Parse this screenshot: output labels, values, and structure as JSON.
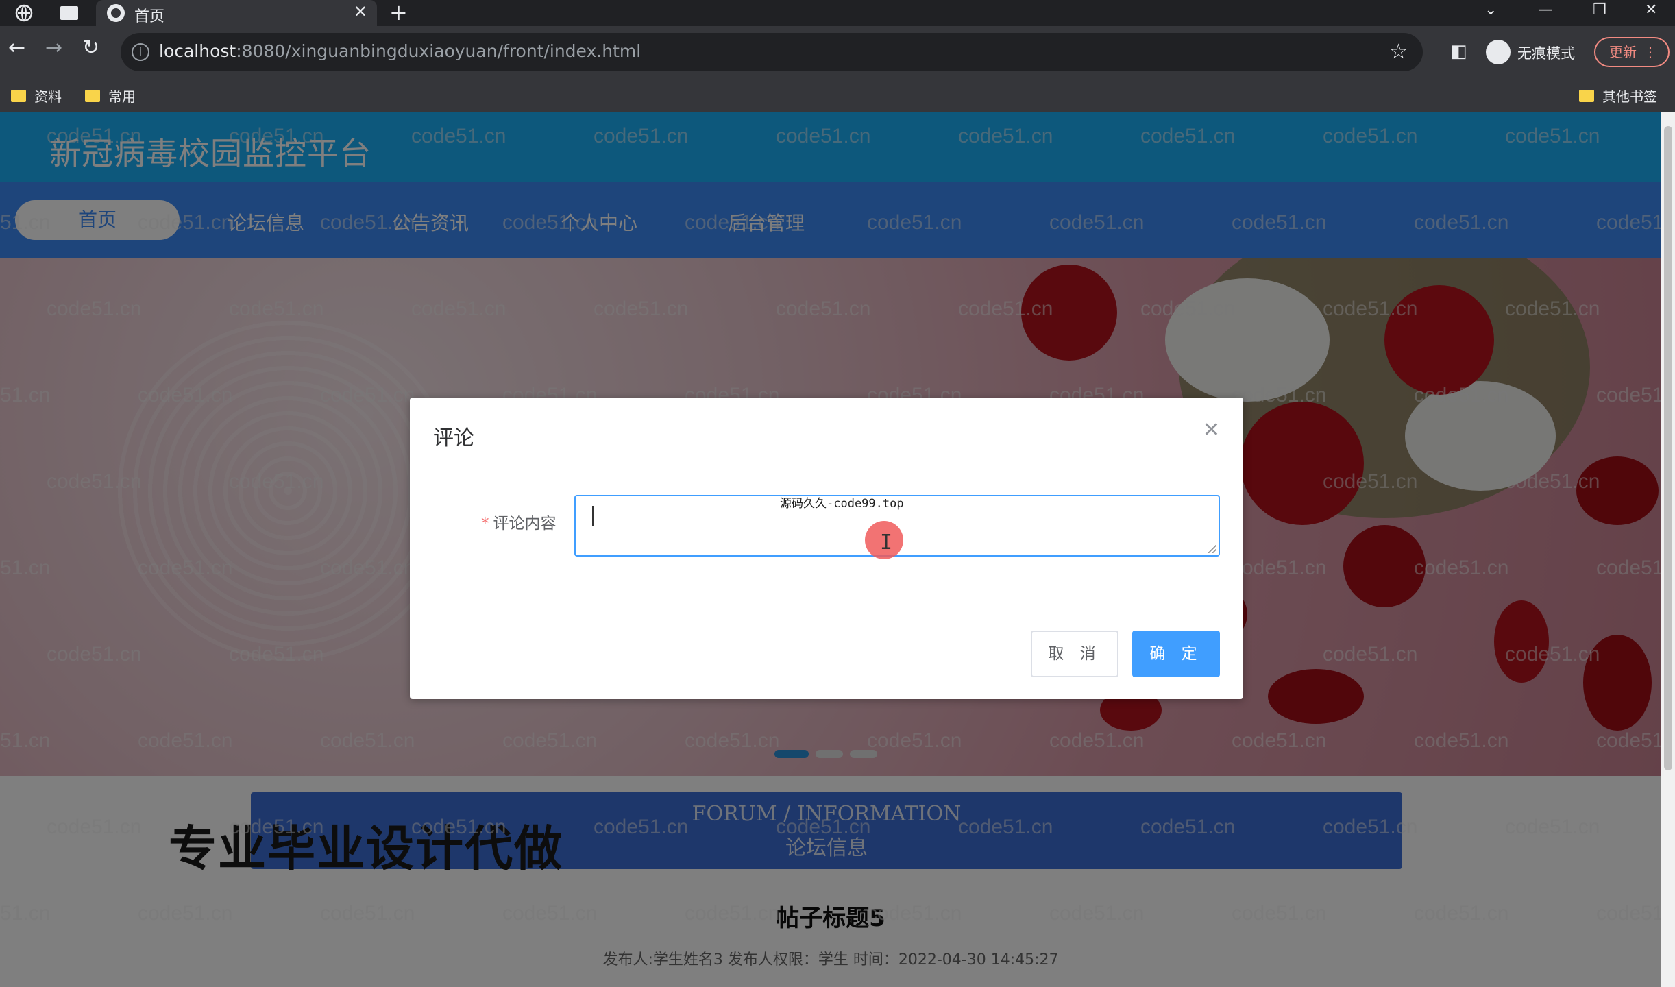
{
  "browser": {
    "tab_title": "首页",
    "url_host": "localhost",
    "url_rest": ":8080/xinguanbingduxiaoyuan/front/index.html",
    "incognito_label": "无痕模式",
    "update_label": "更新",
    "bookmarks": [
      "资料",
      "常用"
    ],
    "other_bookmarks": "其他书签"
  },
  "site": {
    "title": "新冠病毒校园监控平台",
    "nav": [
      "首页",
      "论坛信息",
      "公告资讯",
      "个人中心",
      "后台管理"
    ]
  },
  "section": {
    "en": "FORUM / INFORMATION",
    "cn": "论坛信息"
  },
  "promo": "专业毕业设计代做",
  "post": {
    "title": "帖子标题5",
    "meta": "发布人:学生姓名3   发布人权限：学生   时间：2022-04-30 14:45:27"
  },
  "dialog": {
    "title": "评论",
    "field_label": "评论内容",
    "required_mark": "*",
    "overlay_hint": "源码久久-code99.top",
    "cancel": "取 消",
    "confirm": "确 定"
  },
  "watermark": "code51.cn",
  "colors": {
    "header": "#1ab0f8",
    "nav": "#3d8af7",
    "primary_button": "#409eff"
  }
}
